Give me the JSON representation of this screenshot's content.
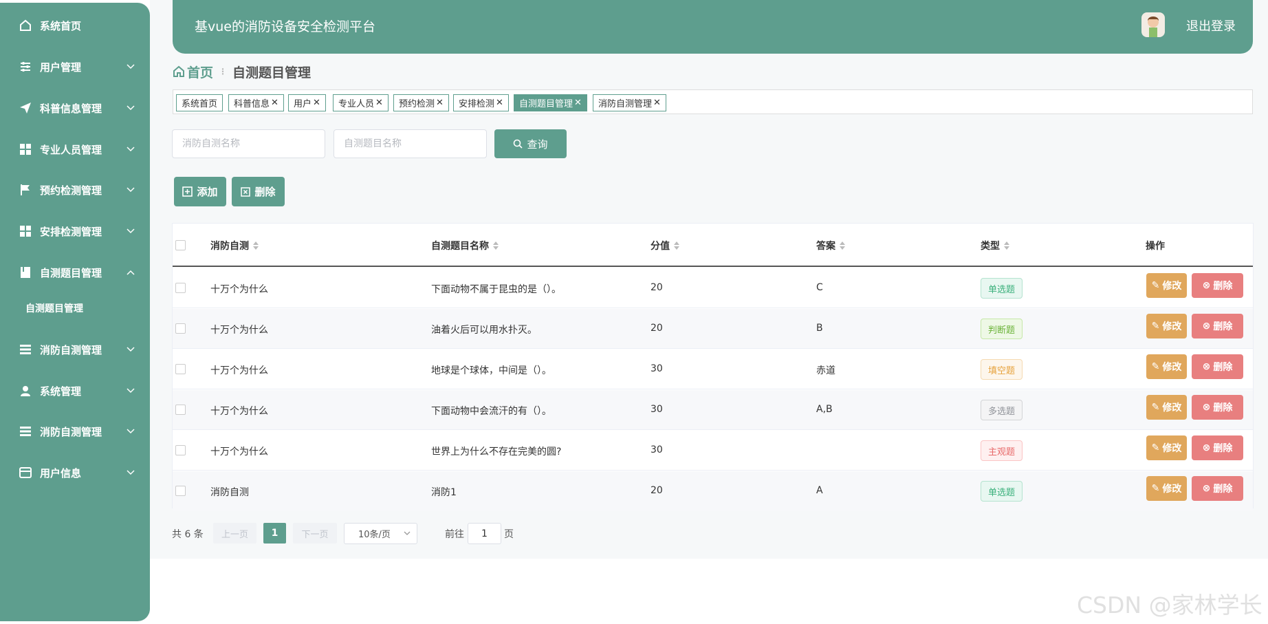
{
  "sidebar": {
    "items": [
      {
        "label": "系统首页",
        "icon": "home-icon"
      },
      {
        "label": "用户管理",
        "icon": "sliders-icon"
      },
      {
        "label": "科普信息管理",
        "icon": "send-icon"
      },
      {
        "label": "专业人员管理",
        "icon": "grid-icon"
      },
      {
        "label": "预约检测管理",
        "icon": "flag-icon"
      },
      {
        "label": "安排检测管理",
        "icon": "grid-icon"
      },
      {
        "label": "自测题目管理",
        "icon": "book-icon"
      },
      {
        "label": "消防自测管理",
        "icon": "list-icon"
      },
      {
        "label": "系统管理",
        "icon": "user-icon"
      },
      {
        "label": "消防自测管理",
        "icon": "list-icon"
      },
      {
        "label": "用户信息",
        "icon": "card-icon"
      }
    ],
    "sub_item": "自测题目管理"
  },
  "header": {
    "title": "基vue的消防设备安全检测平台",
    "logout": "退出登录"
  },
  "breadcrumb": {
    "home": "首页",
    "separator": "⋮",
    "current": "自测题目管理"
  },
  "tabs": [
    {
      "label": "系统首页",
      "closable": false
    },
    {
      "label": "科普信息",
      "closable": true
    },
    {
      "label": "用户",
      "closable": true
    },
    {
      "label": "专业人员",
      "closable": true
    },
    {
      "label": "预约检测",
      "closable": true
    },
    {
      "label": "安排检测",
      "closable": true
    },
    {
      "label": "自测题目管理",
      "closable": true,
      "active": true
    },
    {
      "label": "消防自测管理",
      "closable": true
    }
  ],
  "search": {
    "field1_placeholder": "消防自测名称",
    "field2_placeholder": "自测题目名称",
    "button": "查询"
  },
  "actions": {
    "add": "添加",
    "delete": "删除"
  },
  "table": {
    "columns": [
      "消防自测",
      "自测题目名称",
      "分值",
      "答案",
      "类型",
      "操作"
    ],
    "rows": [
      {
        "test": "十万个为什么",
        "question": "下面动物不属于昆虫的是（）。",
        "score": "20",
        "answer": "C",
        "type": "单选题"
      },
      {
        "test": "十万个为什么",
        "question": "油着火后可以用水扑灭。",
        "score": "20",
        "answer": "B",
        "type": "判断题"
      },
      {
        "test": "十万个为什么",
        "question": "地球是个球体，中间是（）。",
        "score": "30",
        "answer": "赤道",
        "type": "填空题"
      },
      {
        "test": "十万个为什么",
        "question": "下面动物中会流汗的有（）。",
        "score": "30",
        "answer": "A,B",
        "type": "多选题"
      },
      {
        "test": "十万个为什么",
        "question": "世界上为什么不存在完美的圆?",
        "score": "30",
        "answer": "",
        "type": "主观题"
      },
      {
        "test": "消防自测",
        "question": "消防1",
        "score": "20",
        "answer": "A",
        "type": "单选题"
      }
    ],
    "edit_label": "修改",
    "delete_label": "删除"
  },
  "type_colors": {
    "单选题": {
      "bg": "#e8f7f1",
      "border": "#b4e3cf",
      "text": "#3bb07c"
    },
    "判断题": {
      "bg": "#eef8e6",
      "border": "#c6e8a8",
      "text": "#6cb33a"
    },
    "填空题": {
      "bg": "#fdf6ec",
      "border": "#f5dab1",
      "text": "#e6a23c"
    },
    "多选题": {
      "bg": "#f4f4f5",
      "border": "#d3d4d6",
      "text": "#909399"
    },
    "主观题": {
      "bg": "#fef0f0",
      "border": "#fbc4c4",
      "text": "#e86a6a"
    }
  },
  "pagination": {
    "total": "共 6 条",
    "prev": "上一页",
    "page": "1",
    "next": "下一页",
    "page_size": "10条/页",
    "goto_prefix": "前往",
    "goto_value": "1",
    "goto_suffix": "页"
  },
  "watermark": "CSDN @家林学长",
  "colors": {
    "accent": "#5e9e8e",
    "edit": "#e0a75c",
    "delete": "#e87f7f"
  }
}
